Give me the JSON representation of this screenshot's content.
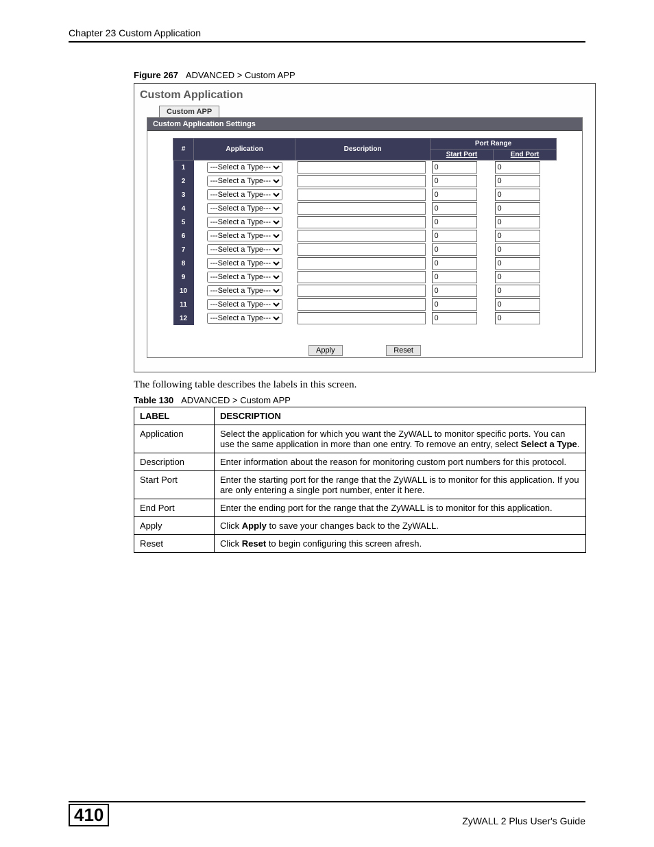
{
  "chapter": "Chapter 23 Custom Application",
  "figure": {
    "num": "Figure 267",
    "caption": "ADVANCED > Custom APP"
  },
  "panel": {
    "title": "Custom Application",
    "tab": "Custom APP",
    "section": "Custom Application Settings",
    "headers": {
      "num": "#",
      "app": "Application",
      "desc": "Description",
      "portrange": "Port Range",
      "start": "Start Port",
      "end": "End Port"
    },
    "select_placeholder": "---Select a Type---",
    "default_port": "0",
    "rows": [
      1,
      2,
      3,
      4,
      5,
      6,
      7,
      8,
      9,
      10,
      11,
      12
    ],
    "buttons": {
      "apply": "Apply",
      "reset": "Reset"
    }
  },
  "intro": "The following table describes the labels in this screen.",
  "table": {
    "num": "Table 130",
    "caption": "ADVANCED > Custom APP",
    "head_label": "LABEL",
    "head_desc": "DESCRIPTION",
    "rows": [
      {
        "label": "Application",
        "desc_pre": "Select the application for which you want the ZyWALL to monitor specific ports. You can use the same application in more than one entry. To remove an entry, select ",
        "desc_bold": "Select a Type",
        "desc_post": "."
      },
      {
        "label": "Description",
        "desc": "Enter information about the reason for monitoring custom port numbers for this protocol."
      },
      {
        "label": "Start Port",
        "desc": "Enter the starting port for the range that the ZyWALL is to monitor for this application. If you are only entering a single port number, enter it here."
      },
      {
        "label": "End Port",
        "desc": "Enter the ending port for the range that the ZyWALL is to monitor for this application."
      },
      {
        "label": "Apply",
        "desc_pre": "Click ",
        "desc_bold": "Apply",
        "desc_post": " to save your changes back to the ZyWALL."
      },
      {
        "label": "Reset",
        "desc_pre": "Click ",
        "desc_bold": "Reset",
        "desc_post": " to begin configuring this screen afresh."
      }
    ]
  },
  "footer": {
    "page": "410",
    "guide": "ZyWALL 2 Plus User's Guide"
  }
}
